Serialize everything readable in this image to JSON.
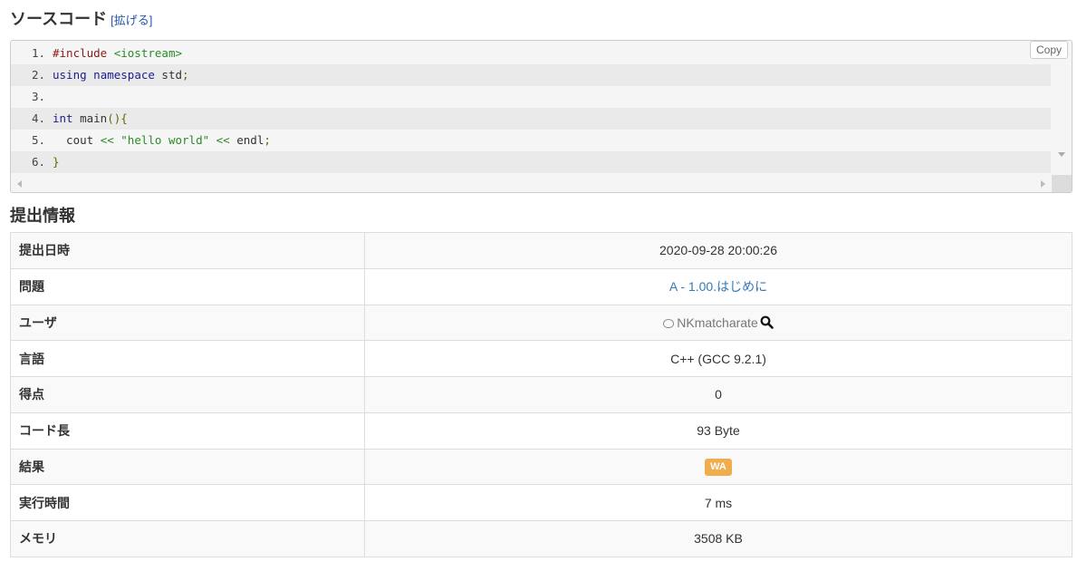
{
  "source_section": {
    "title": "ソースコード",
    "expand_label": "[拡げる]",
    "copy_label": "Copy"
  },
  "code": {
    "line_numbers": [
      "1.",
      "2.",
      "3.",
      "4.",
      "5.",
      "6."
    ]
  },
  "info_section": {
    "title": "提出情報"
  },
  "info": {
    "submission_time": {
      "label": "提出日時",
      "value": "2020-09-28 20:00:26"
    },
    "problem": {
      "label": "問題",
      "value": "A - 1.00.はじめに"
    },
    "user": {
      "label": "ユーザ",
      "value": "NKmatcharate"
    },
    "language": {
      "label": "言語",
      "value": "C++ (GCC 9.2.1)"
    },
    "score": {
      "label": "得点",
      "value": "0"
    },
    "code_length": {
      "label": "コード長",
      "value": "93 Byte"
    },
    "result": {
      "label": "結果",
      "value": "WA",
      "color": "#f0ad4e"
    },
    "exec_time": {
      "label": "実行時間",
      "value": "7 ms"
    },
    "memory": {
      "label": "メモリ",
      "value": "3508 KB"
    }
  },
  "icons": {
    "user": "user-icon",
    "search": "search-icon"
  }
}
